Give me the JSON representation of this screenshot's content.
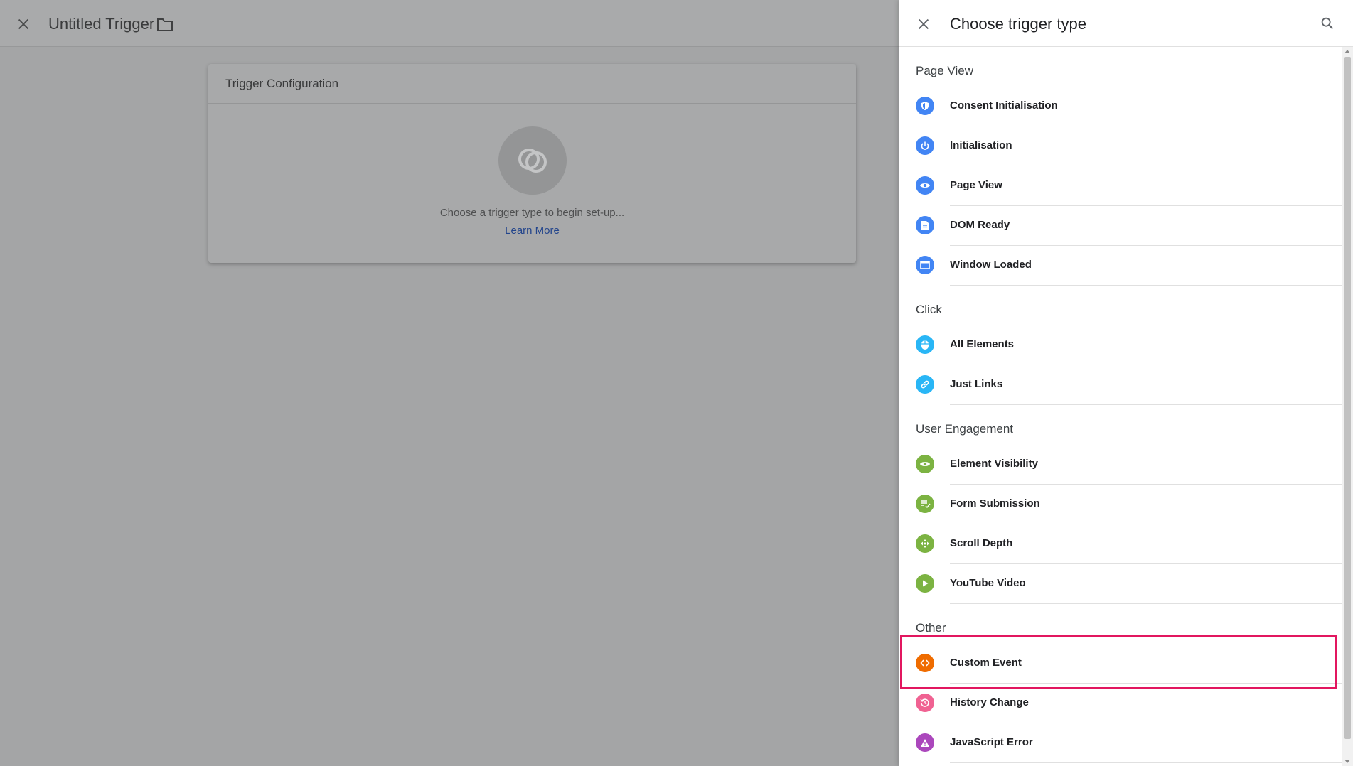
{
  "editor": {
    "title": "Untitled Trigger",
    "card_title": "Trigger Configuration",
    "hint": "Choose a trigger type to begin set-up...",
    "learn_more": "Learn More"
  },
  "panel": {
    "title": "Choose trigger type",
    "sections": [
      {
        "title": "Page View",
        "items": [
          {
            "label": "Consent Initialisation",
            "icon": "shield-icon",
            "color": "#4285f4"
          },
          {
            "label": "Initialisation",
            "icon": "power-icon",
            "color": "#4285f4"
          },
          {
            "label": "Page View",
            "icon": "eye-icon",
            "color": "#4285f4"
          },
          {
            "label": "DOM Ready",
            "icon": "document-icon",
            "color": "#4285f4"
          },
          {
            "label": "Window Loaded",
            "icon": "window-icon",
            "color": "#4285f4"
          }
        ]
      },
      {
        "title": "Click",
        "items": [
          {
            "label": "All Elements",
            "icon": "mouse-icon",
            "color": "#29b6f6"
          },
          {
            "label": "Just Links",
            "icon": "link-icon",
            "color": "#29b6f6"
          }
        ]
      },
      {
        "title": "User Engagement",
        "items": [
          {
            "label": "Element Visibility",
            "icon": "eye-icon",
            "color": "#7cb342"
          },
          {
            "label": "Form Submission",
            "icon": "form-check-icon",
            "color": "#7cb342"
          },
          {
            "label": "Scroll Depth",
            "icon": "move-arrows-icon",
            "color": "#7cb342"
          },
          {
            "label": "YouTube Video",
            "icon": "play-icon",
            "color": "#7cb342"
          }
        ]
      },
      {
        "title": "Other",
        "items": [
          {
            "label": "Custom Event",
            "icon": "code-icon",
            "color": "#ef6c00"
          },
          {
            "label": "History Change",
            "icon": "history-icon",
            "color": "#f06292"
          },
          {
            "label": "JavaScript Error",
            "icon": "warning-icon",
            "color": "#ab47bc"
          }
        ]
      }
    ]
  }
}
